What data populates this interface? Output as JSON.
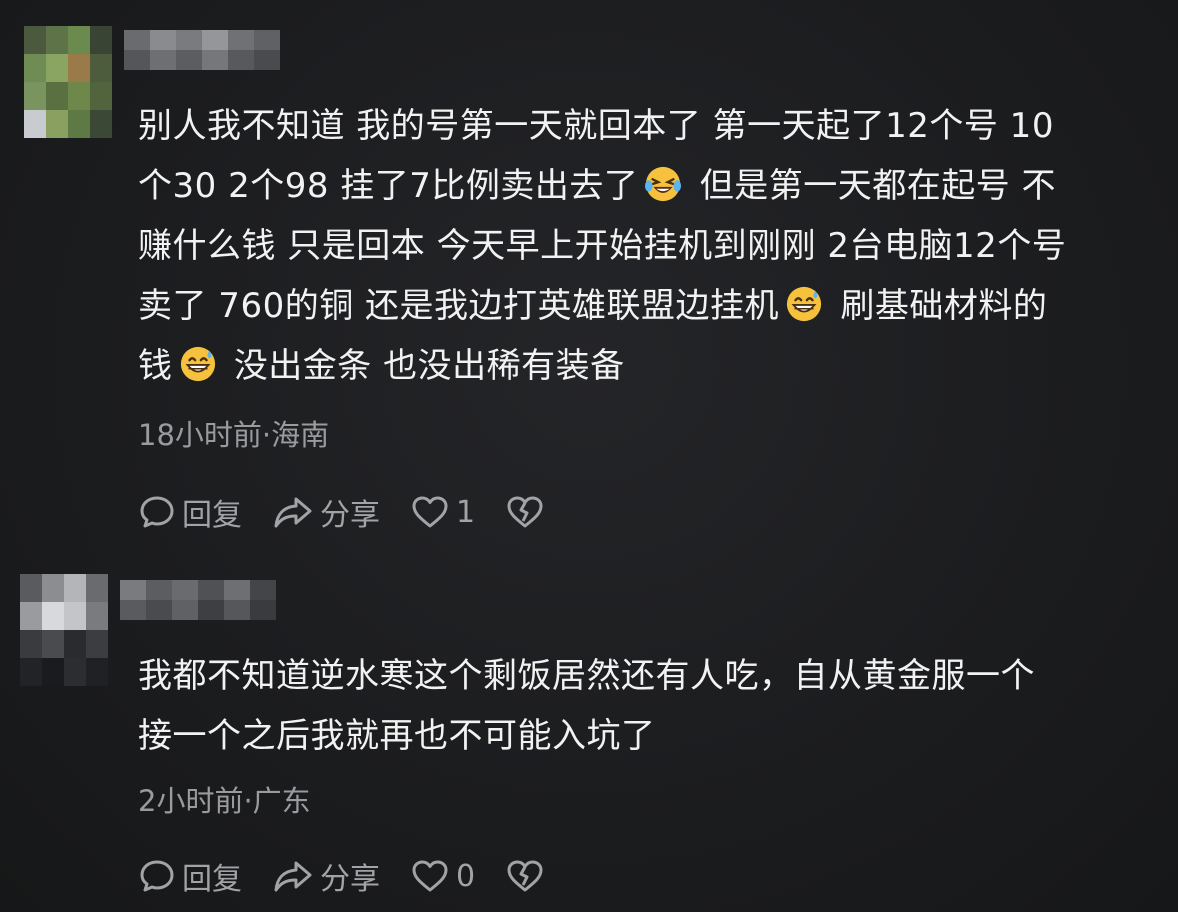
{
  "comments": [
    {
      "text_lines": [
        "别人我不知道 我的号第一天就回本了 第一天起了12个号 10",
        "个30 2个98 挂了7比例卖出去了",
        "但是第一天都在起号 不",
        "赚什么钱 只是回本 今天早上开始挂机到刚刚 2台电脑12个号",
        "卖了 760的铜 还是我边打英雄联盟边挂机",
        "刷基础材料的",
        "钱",
        "没出金条 也没出稀有装备"
      ],
      "emojis": [
        "laughing-crying-emoji",
        "grinning-sweat-emoji",
        "grinning-sweat-emoji"
      ],
      "time_location": "18小时前·海南",
      "reply_label": "回复",
      "share_label": "分享",
      "like_count": "1"
    },
    {
      "text_lines": [
        "我都不知道逆水寒这个剩饭居然还有人吃，自从黄金服一个",
        "接一个之后我就再也不可能入坑了"
      ],
      "time_location": "2小时前·广东",
      "reply_label": "回复",
      "share_label": "分享",
      "like_count": "0"
    }
  ],
  "colors": {
    "background": "#1b1c1e",
    "text": "#f2f2f2",
    "muted": "#9a9b9e"
  },
  "icons": [
    "comment-bubble-icon",
    "share-arrow-icon",
    "heart-icon",
    "broken-heart-icon"
  ]
}
